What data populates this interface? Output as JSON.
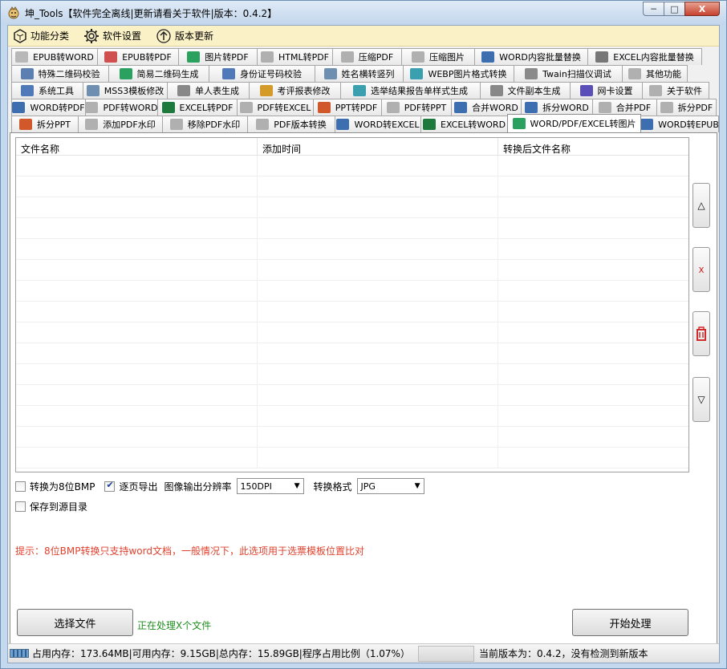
{
  "window": {
    "title": "坤_Tools【软件完全离线|更新请看关于软件|版本：0.4.2】",
    "min_label": "─",
    "max_label": "□",
    "close_label": "X"
  },
  "menu": [
    {
      "label": "功能分类",
      "icon": "category-icon"
    },
    {
      "label": "软件设置",
      "icon": "gear-icon"
    },
    {
      "label": "版本更新",
      "icon": "update-icon"
    }
  ],
  "tab_rows": [
    [
      {
        "label": "EPUB转WORD",
        "color": "#b8b8b8",
        "w": 108
      },
      {
        "label": "EPUB转PDF",
        "color": "#d05050",
        "w": 102
      },
      {
        "label": "图片转PDF",
        "color": "#2aa15e",
        "w": 99
      },
      {
        "label": "HTML转PDF",
        "color": "#b0b0b0",
        "w": 95
      },
      {
        "label": "压缩PDF",
        "color": "#b0b0b0",
        "w": 87
      },
      {
        "label": "压缩图片",
        "color": "#b0b0b0",
        "w": 92
      },
      {
        "label": "WORD内容批量替换",
        "color": "#3d6fb0",
        "w": 142
      },
      {
        "label": "EXCEL内容批量替换",
        "color": "#777777",
        "w": 143
      }
    ],
    [
      {
        "label": "特殊二维码校验",
        "color": "#5a7fb0",
        "w": 122
      },
      {
        "label": "简易二维码生成",
        "color": "#2aa15e",
        "w": 126
      },
      {
        "label": "身份证号码校验",
        "color": "#4f79b8",
        "w": 133
      },
      {
        "label": "姓名横转竖列",
        "color": "#6f8fb0",
        "w": 111
      },
      {
        "label": "WEBP图片格式转换",
        "color": "#3aa0b0",
        "w": 139
      },
      {
        "label": "Twain扫描仪调试",
        "color": "#8a8a8a",
        "w": 136
      },
      {
        "label": "其他功能",
        "color": "#b0b0b0",
        "w": 82
      }
    ],
    [
      {
        "label": "系统工具",
        "color": "#4f79b8",
        "w": 90
      },
      {
        "label": "MSS3模板修改",
        "color": "#6f8fb0",
        "w": 106
      },
      {
        "label": "单人表生成",
        "color": "#888888",
        "w": 103
      },
      {
        "label": "考评报表修改",
        "color": "#d49a2a",
        "w": 115
      },
      {
        "label": "选举结果报告单样式生成",
        "color": "#3aa0b0",
        "w": 175
      },
      {
        "label": "文件副本生成",
        "color": "#888888",
        "w": 113
      },
      {
        "label": "网卡设置",
        "color": "#5a4fb8",
        "w": 91
      },
      {
        "label": "关于软件",
        "color": "#b0b0b0",
        "w": 84
      }
    ],
    [
      {
        "label": "WORD转PDF",
        "color": "#3d6fb0",
        "w": 93
      },
      {
        "label": "PDF转WORD",
        "color": "#b0b0b0",
        "w": 91
      },
      {
        "label": "EXCEL转PDF",
        "color": "#1e7a3c",
        "w": 100
      },
      {
        "label": "PDF转EXCEL",
        "color": "#b0b0b0",
        "w": 96
      },
      {
        "label": "PPT转PDF",
        "color": "#d0582a",
        "w": 86
      },
      {
        "label": "PDF转PPT",
        "color": "#b0b0b0",
        "w": 88
      },
      {
        "label": "合并WORD",
        "color": "#3d6fb0",
        "w": 88
      },
      {
        "label": "拆分WORD",
        "color": "#3d6fb0",
        "w": 90
      },
      {
        "label": "合并PDF",
        "color": "#b0b0b0",
        "w": 81
      },
      {
        "label": "拆分PDF",
        "color": "#b0b0b0",
        "w": 75
      }
    ],
    [
      {
        "label": "拆分PPT",
        "color": "#d0582a",
        "w": 84
      },
      {
        "label": "添加PDF水印",
        "color": "#b0b0b0",
        "w": 106
      },
      {
        "label": "移除PDF水印",
        "color": "#b0b0b0",
        "w": 107
      },
      {
        "label": "PDF版本转换",
        "color": "#b0b0b0",
        "w": 110
      },
      {
        "label": "WORD转EXCEL",
        "color": "#3d6fb0",
        "w": 108
      },
      {
        "label": "EXCEL转WORD",
        "color": "#1e7a3c",
        "w": 109
      },
      {
        "label": "WORD/PDF/EXCEL转图片",
        "color": "#2aa15e",
        "w": 167,
        "active": true
      },
      {
        "label": "WORD转EPUB",
        "color": "#3d6fb0",
        "w": 98
      }
    ]
  ],
  "table": {
    "headers": [
      "文件名称",
      "添加时间",
      "转换后文件名称"
    ],
    "rows": []
  },
  "side_buttons": [
    {
      "name": "move-up-button",
      "label": "△",
      "color": "#333333"
    },
    {
      "name": "delete-button",
      "label": "x",
      "color": "#d22b2b"
    },
    {
      "name": "clear-button",
      "label": "",
      "color": "#d22b2b"
    },
    {
      "name": "move-down-button",
      "label": "▽",
      "color": "#333333"
    }
  ],
  "options": {
    "bmp_label": "转换为8位BMP",
    "bmp_checked": false,
    "page_export_label": "逐页导出",
    "page_export_checked": true,
    "dpi_label": "图像输出分辨率",
    "dpi_value": "150DPI",
    "format_label": "转换格式",
    "format_value": "JPG",
    "save_src_label": "保存到源目录",
    "save_src_checked": false
  },
  "hint": "提示：8位BMP转换只支持word文档，一般情况下，此选项用于选票模板位置比对",
  "buttons": {
    "select_file": "选择文件",
    "start": "开始处理"
  },
  "processing_text": "正在处理X个文件",
  "status": {
    "memory_text": "占用内存：173.64MB|可用内存：9.15GB|总内存：15.89GB|程序占用比例（1.07%）",
    "progress_fraction": 0.0,
    "version_text": "当前版本为：0.4.2，没有检测到新版本"
  }
}
